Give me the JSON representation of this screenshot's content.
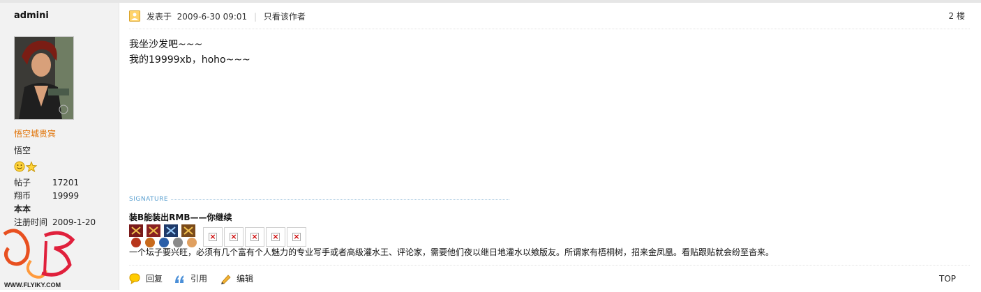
{
  "sidebar": {
    "username": "admini",
    "user_group": "悟空城贵宾",
    "nickname": "悟空",
    "medal_icons": [
      "smiley-medal-icon",
      "star-medal-icon"
    ],
    "stats": [
      {
        "label": "帖子",
        "value": "17201"
      },
      {
        "label": "翔币",
        "value": "19999"
      },
      {
        "label": "本本",
        "value": ""
      },
      {
        "label": "注册时间",
        "value": "2009-1-20"
      }
    ],
    "logo_text": "WWW.FLYIKY.COM"
  },
  "post": {
    "posted_label": "发表于",
    "posted_time": "2009-6-30 09:01",
    "separator": "|",
    "author_only_link": "只看该作者",
    "floor": "2 楼",
    "content_lines": [
      "我坐沙发吧~~~",
      "我的19999xb，hoho~~~"
    ],
    "signature_label": "SIGNATURE",
    "signature_title": "装B能装出RMB——你继续",
    "signature_text": "一个坛子要兴旺，必须有几个富有个人魅力的专业写手或者高级灌水王、评论家，需要他们夜以继日地灌水以飨版友。所谓家有梧桐树，招来金凤凰。看贴跟贴就会纷至沓来。",
    "actions": {
      "reply": "回复",
      "quote": "引用",
      "edit": "编辑"
    },
    "top_link": "TOP"
  },
  "colors": {
    "user_group": "#e07000",
    "sidebar_bg": "#f2f2f2",
    "signature_label": "#5aa0d0"
  }
}
